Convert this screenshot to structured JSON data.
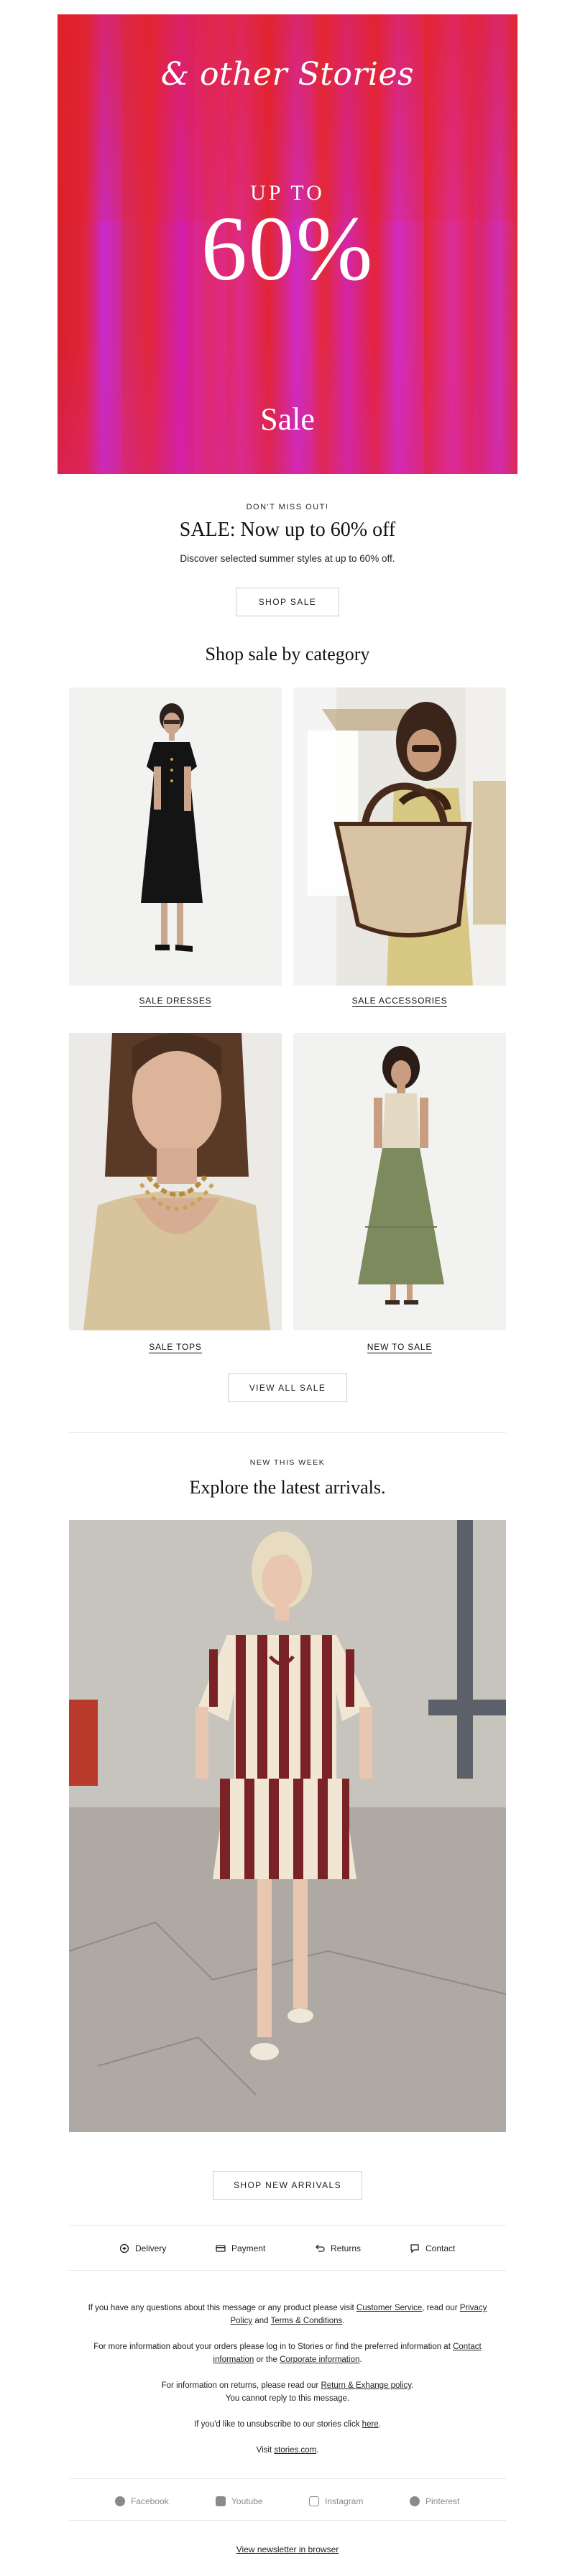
{
  "hero": {
    "logo": "& other Stories",
    "up_to": "UP TO",
    "percent": "60%",
    "sale": "Sale"
  },
  "intro": {
    "eyebrow": "DON'T MISS OUT!",
    "title": "SALE: Now up to 60% off",
    "subtitle": "Discover selected summer styles at up to 60% off.",
    "cta": "SHOP SALE"
  },
  "categories": {
    "heading": "Shop sale by category",
    "items": [
      {
        "label": "SALE DRESSES",
        "image": "woman-in-black-dress"
      },
      {
        "label": "SALE ACCESSORIES",
        "image": "woman-with-straw-tote-bag"
      },
      {
        "label": "SALE  TOPS",
        "image": "woman-in-beige-knit-top"
      },
      {
        "label": "NEW TO SALE",
        "image": "woman-in-green-maxi-skirt"
      }
    ],
    "cta": "VIEW ALL SALE"
  },
  "new_arrivals": {
    "eyebrow": "NEW THIS WEEK",
    "title": "Explore the latest arrivals.",
    "image": "woman-in-striped-dress",
    "cta": "SHOP NEW ARRIVALS"
  },
  "services": [
    {
      "label": "Delivery",
      "icon": "delivery-icon"
    },
    {
      "label": "Payment",
      "icon": "card-icon"
    },
    {
      "label": "Returns",
      "icon": "return-icon"
    },
    {
      "label": "Contact",
      "icon": "chat-icon"
    }
  ],
  "footer": {
    "p1_pre": "If you have any questions about this message or any product please visit ",
    "p1_link1": "Customer Service",
    "p1_mid": ", read our ",
    "p1_link2": "Privacy Policy",
    "p1_and": " and ",
    "p1_link3": "Terms & Conditions",
    "p1_end": ".",
    "p2_pre": "For more information about your orders please log in to Stories or find the preferred information at ",
    "p2_link1": "Contact information",
    "p2_mid": " or the ",
    "p2_link2": "Corporate information",
    "p2_end": ".",
    "p3_pre": "For information on returns, please read our ",
    "p3_link": "Return & Exhange policy",
    "p3_end": ".",
    "p3_line2": "You cannot reply to this message.",
    "p4_pre": "If you'd like to unsubscribe to our stories click ",
    "p4_link": "here",
    "p4_end": ".",
    "p5_pre": "Visit ",
    "p5_link": "stories.com",
    "p5_end": "."
  },
  "social": [
    {
      "label": "Facebook",
      "icon": "facebook-icon"
    },
    {
      "label": "Youtube",
      "icon": "youtube-icon"
    },
    {
      "label": "Instagram",
      "icon": "instagram-icon"
    },
    {
      "label": "Pinterest",
      "icon": "pinterest-icon"
    }
  ],
  "browser_link": "View newsletter in browser",
  "colors": {
    "hero_red": "#e2243a",
    "hero_magenta": "#d02bc0",
    "text": "#1a1a1a",
    "muted": "#8a8a8a",
    "border": "#cfcfcf"
  }
}
